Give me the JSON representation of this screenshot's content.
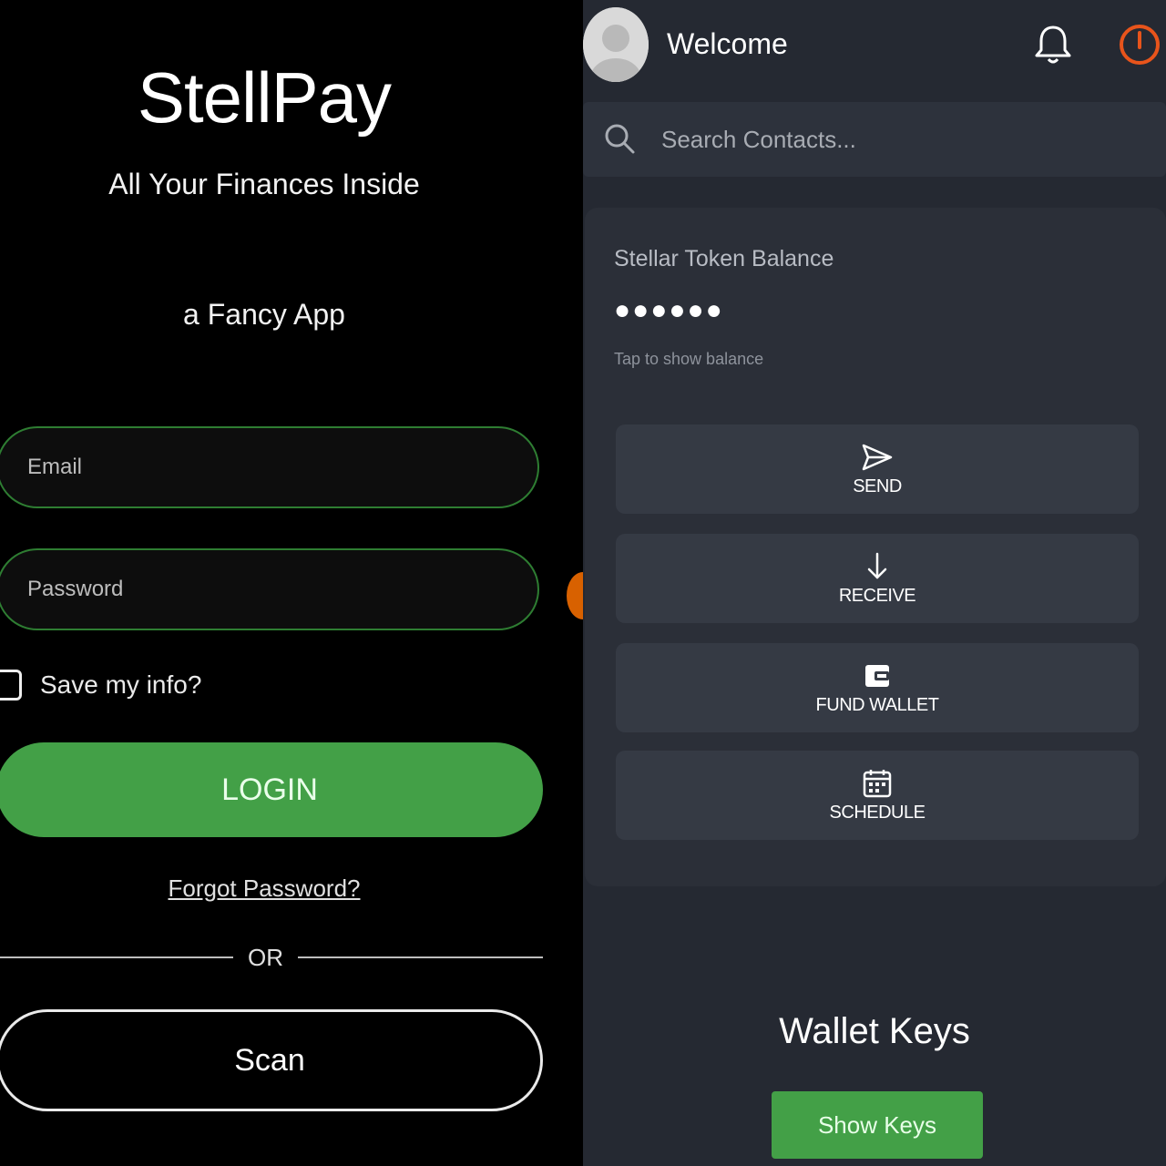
{
  "login": {
    "brand": "StellPay",
    "tagline": "All Your Finances Inside",
    "subtagline": "a Fancy App",
    "email_placeholder": "Email",
    "password_placeholder": "Password",
    "save_label": "Save my info?",
    "login_label": "LOGIN",
    "forgot_label": "Forgot Password?",
    "or_label": "OR",
    "scan_label": "Scan"
  },
  "dashboard": {
    "welcome": "Welcome",
    "search_placeholder": "Search Contacts...",
    "balance_title": "Stellar Token Balance",
    "balance_masked": "●●●●●●",
    "balance_hint": "Tap to show balance",
    "actions": [
      {
        "label": "SEND",
        "icon": "send-icon"
      },
      {
        "label": "RECEIVE",
        "icon": "arrow-down-icon"
      },
      {
        "label": "FUND WALLET",
        "icon": "wallet-icon"
      },
      {
        "label": "SCHEDULE",
        "icon": "calendar-icon"
      }
    ],
    "wallet_keys_title": "Wallet Keys",
    "show_keys_label": "Show Keys"
  },
  "colors": {
    "accent_green": "#43a047",
    "field_border_green": "#2e7d32",
    "power_orange": "#e8541b",
    "dashboard_bg": "#252932"
  }
}
